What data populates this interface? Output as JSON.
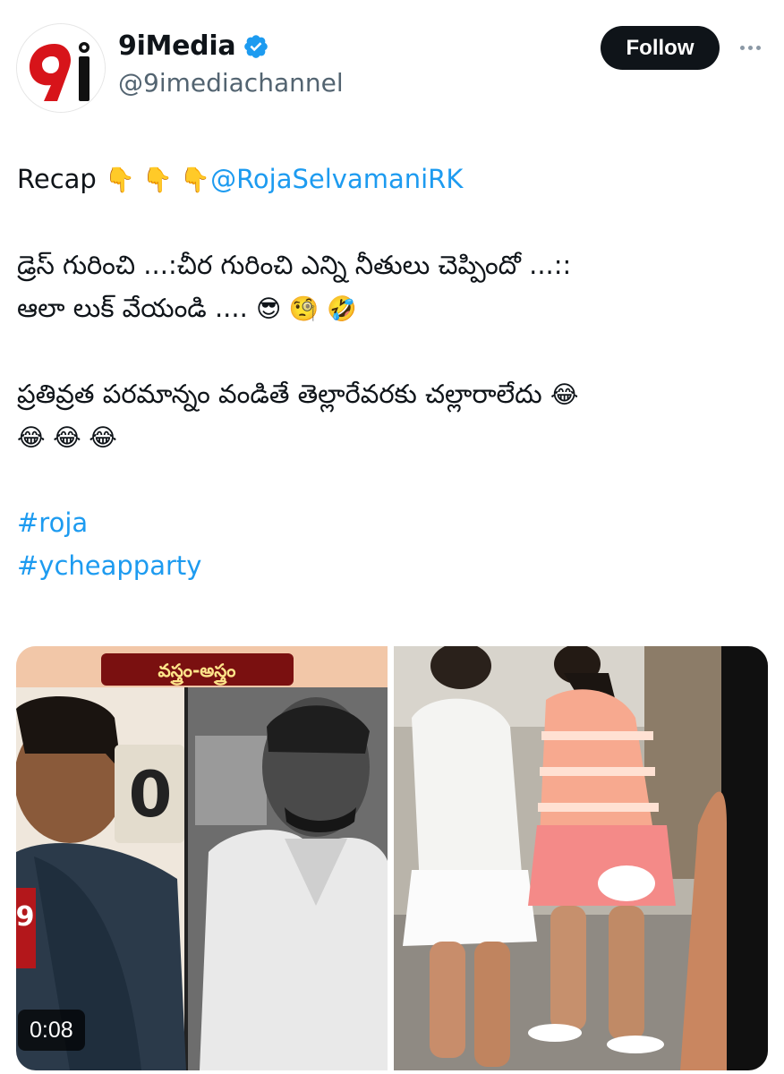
{
  "author": {
    "display_name": "9iMedia",
    "handle": "@9imediachannel",
    "avatar_icon": "9i-logo-icon",
    "verified_icon": "verified-badge-icon",
    "verified_color": "#1d9bf0"
  },
  "actions": {
    "follow_label": "Follow",
    "more_icon": "more-horizontal-icon"
  },
  "tweet": {
    "line1_text": "Recap ",
    "line1_emojis": "👇 👇 👇",
    "mention": "@RojaSelvamaniRK",
    "line2": "డ్రెస్ గురించి ...:చీర గురించి ఎన్ని నీతులు చెప్పిందో ...::",
    "line3_text": "ఆలా లుక్ వేయండి .... ",
    "line3_emojis": "😎 🧐 🤣",
    "line4_text": "ప్రతివ్రత పరమాన్నం వండితే తెల్లారేవరకు చల్లారాలేదు ",
    "line4_emojis": "😂",
    "line5_emojis": "😂 😂 😂",
    "hashtags": [
      "#roja",
      "#ycheapparty"
    ]
  },
  "media": {
    "video_caption": "వస్త్రం-అస్త్రం",
    "video_duration": "0:08"
  },
  "colors": {
    "link": "#1d9bf0",
    "text": "#0f1419",
    "secondary": "#536471",
    "follow_bg": "#0f1419",
    "brand_red": "#d7141a"
  }
}
